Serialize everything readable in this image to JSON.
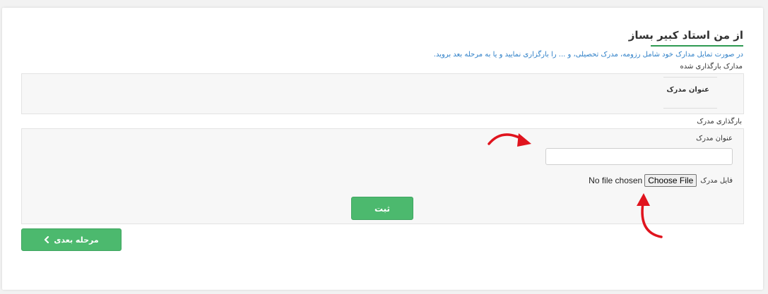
{
  "page": {
    "title": "از من استاد کبیر بساز",
    "subtitle": "در صورت تمایل مدارک خود شامل رزومه، مدرک تحصیلی، و ... را بارگزاری نمایید و یا به مرحله بعد بروید."
  },
  "uploaded_documents": {
    "label": "مدارک بارگذاری شده",
    "columns": [
      "عنوان مدرک"
    ]
  },
  "upload_form": {
    "label": "بارگذاری مدرک",
    "title_field_label": "عنوان مدرک",
    "title_field_value": "",
    "file_field_label": "فایل مدرک",
    "choose_file_label": "Choose File",
    "no_file_text": "No file chosen",
    "submit_label": "ثبت"
  },
  "navigation": {
    "next_label": "مرحله بعدی"
  },
  "colors": {
    "accent_green": "#4cb96e",
    "link_blue": "#2f80c8",
    "annotation_red": "#e0141e"
  },
  "icons": {
    "next": "chevron-left-icon",
    "annotations": [
      "red-curved-arrow-icon",
      "red-curved-arrow-icon"
    ]
  }
}
